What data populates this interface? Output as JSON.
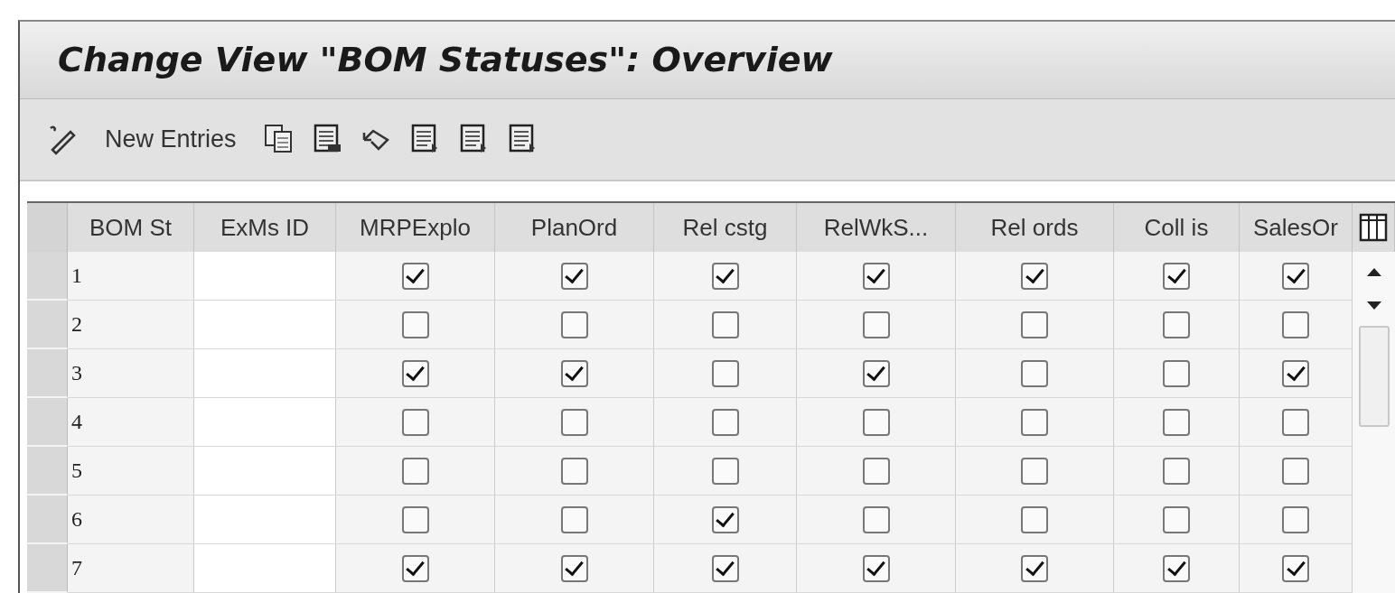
{
  "window": {
    "title": "Change View \"BOM Statuses\": Overview"
  },
  "toolbar": {
    "new_entries": "New Entries"
  },
  "table": {
    "columns": [
      "BOM St",
      "ExMs ID",
      "MRPExplo",
      "PlanOrd",
      "Rel cstg",
      "RelWkS...",
      "Rel ords",
      "Coll is",
      "SalesOr"
    ],
    "rows": [
      {
        "status": "1",
        "exms_id": "",
        "checks": [
          {
            "checked": true
          },
          {
            "checked": true
          },
          {
            "checked": true
          },
          {
            "checked": true
          },
          {
            "checked": true
          },
          {
            "checked": true
          },
          {
            "checked": true
          }
        ]
      },
      {
        "status": "2",
        "exms_id": "",
        "checks": [
          {
            "checked": false
          },
          {
            "checked": false
          },
          {
            "checked": false
          },
          {
            "checked": false
          },
          {
            "checked": false
          },
          {
            "checked": false
          },
          {
            "checked": false
          }
        ]
      },
      {
        "status": "3",
        "exms_id": "",
        "checks": [
          {
            "checked": true
          },
          {
            "checked": true
          },
          {
            "checked": false
          },
          {
            "checked": true
          },
          {
            "checked": false
          },
          {
            "checked": false
          },
          {
            "checked": true
          }
        ]
      },
      {
        "status": "4",
        "exms_id": "",
        "checks": [
          {
            "checked": false
          },
          {
            "checked": false
          },
          {
            "checked": false
          },
          {
            "checked": false
          },
          {
            "checked": false
          },
          {
            "checked": false
          },
          {
            "checked": false
          }
        ]
      },
      {
        "status": "5",
        "exms_id": "",
        "checks": [
          {
            "checked": false
          },
          {
            "checked": false
          },
          {
            "checked": false
          },
          {
            "checked": false
          },
          {
            "checked": false
          },
          {
            "checked": false
          },
          {
            "checked": false
          }
        ]
      },
      {
        "status": "6",
        "exms_id": "",
        "checks": [
          {
            "checked": false
          },
          {
            "checked": false
          },
          {
            "checked": true
          },
          {
            "checked": false
          },
          {
            "checked": false
          },
          {
            "checked": false
          },
          {
            "checked": false
          }
        ]
      },
      {
        "status": "7",
        "exms_id": "",
        "checks": [
          {
            "checked": true
          },
          {
            "checked": true
          },
          {
            "checked": true
          },
          {
            "checked": true
          },
          {
            "checked": true
          },
          {
            "checked": true
          },
          {
            "checked": true
          }
        ]
      }
    ]
  }
}
